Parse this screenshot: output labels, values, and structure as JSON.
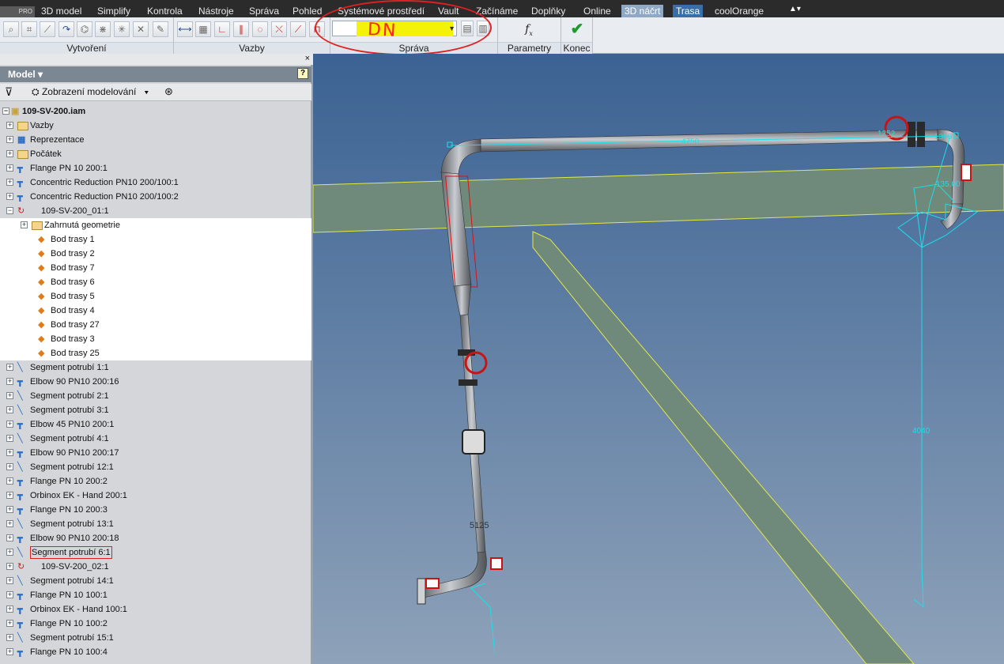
{
  "menu": {
    "logo": "PRO",
    "tabs": [
      "3D model",
      "Simplify",
      "Kontrola",
      "Nástroje",
      "Správa",
      "Pohled",
      "Systémové prostředí",
      "Vault",
      "Začínáme",
      "Doplňky",
      "Online",
      "3D náčrt",
      "Trasa",
      "coolOrange"
    ]
  },
  "ribbon": {
    "groups": {
      "create": "Vytvoření",
      "constraints": "Vazby",
      "manage": "Správa",
      "parameters": "Parametry",
      "finish": "Konec"
    },
    "combo_value": "DN"
  },
  "browser": {
    "title": "Model",
    "view_mode": "Zobrazení modelování",
    "root": "109-SV-200.iam",
    "items": [
      {
        "label": "Vazby",
        "icon": "folder-icon"
      },
      {
        "label": "Reprezentace",
        "icon": "representation-icon"
      },
      {
        "label": "Počátek",
        "icon": "folder-icon"
      },
      {
        "label": "Flange PN 10 200:1",
        "icon": "flange-icon"
      },
      {
        "label": "Concentric Reduction PN10 200/100:1",
        "icon": "flange-icon"
      },
      {
        "label": "Concentric Reduction PN10 200/100:2",
        "icon": "flange-icon"
      },
      {
        "label": "109-SV-200_01:1",
        "icon": "route-icon"
      },
      {
        "label": "Zahrnutá geometrie",
        "icon": "folder-icon"
      },
      {
        "label": "Bod trasy 1",
        "icon": "point-icon"
      },
      {
        "label": "Bod trasy 2",
        "icon": "point-icon"
      },
      {
        "label": "Bod trasy 7",
        "icon": "point-icon"
      },
      {
        "label": "Bod trasy 6",
        "icon": "point-icon"
      },
      {
        "label": "Bod trasy 5",
        "icon": "point-icon"
      },
      {
        "label": "Bod trasy 4",
        "icon": "point-icon"
      },
      {
        "label": "Bod trasy 27",
        "icon": "point-icon"
      },
      {
        "label": "Bod trasy 3",
        "icon": "point-icon"
      },
      {
        "label": "Bod trasy 25",
        "icon": "point-icon"
      },
      {
        "label": "Segment potrubí 1:1",
        "icon": "segment-icon"
      },
      {
        "label": "Elbow 90 PN10 200:16",
        "icon": "flange-icon"
      },
      {
        "label": "Segment potrubí 2:1",
        "icon": "segment-icon"
      },
      {
        "label": "Segment potrubí 3:1",
        "icon": "segment-icon"
      },
      {
        "label": "Elbow 45 PN10 200:1",
        "icon": "flange-icon"
      },
      {
        "label": "Segment potrubí 4:1",
        "icon": "segment-icon"
      },
      {
        "label": "Elbow 90 PN10 200:17",
        "icon": "flange-icon"
      },
      {
        "label": "Segment potrubí 12:1",
        "icon": "segment-icon"
      },
      {
        "label": "Flange PN 10 200:2",
        "icon": "flange-icon"
      },
      {
        "label": "Orbinox EK - Hand 200:1",
        "icon": "flange-icon"
      },
      {
        "label": "Flange PN 10 200:3",
        "icon": "flange-icon"
      },
      {
        "label": "Segment potrubí 13:1",
        "icon": "segment-icon"
      },
      {
        "label": "Elbow 90 PN10 200:18",
        "icon": "flange-icon"
      },
      {
        "label": "Segment potrubí 6:1",
        "icon": "segment-icon"
      },
      {
        "label": "109-SV-200_02:1",
        "icon": "route-icon"
      },
      {
        "label": "Segment potrubí 14:1",
        "icon": "segment-icon"
      },
      {
        "label": "Flange PN 10 100:1",
        "icon": "flange-icon"
      },
      {
        "label": "Orbinox EK - Hand 100:1",
        "icon": "flange-icon"
      },
      {
        "label": "Flange PN 10 100:2",
        "icon": "flange-icon"
      },
      {
        "label": "Segment potrubí 15:1",
        "icon": "segment-icon"
      },
      {
        "label": "Flange PN 10 100:4",
        "icon": "flange-icon"
      }
    ]
  },
  "viewport": {
    "dimensions": [
      "4750",
      "1252",
      "1350",
      "135.00",
      "4040",
      "5125"
    ],
    "colors": {
      "sky_top": "#3b6293",
      "sky_bottom": "#8ea2b9",
      "plane": "#6f8a7a",
      "route_lines": "#19e0e8",
      "pipe": "#8a8e93"
    }
  }
}
